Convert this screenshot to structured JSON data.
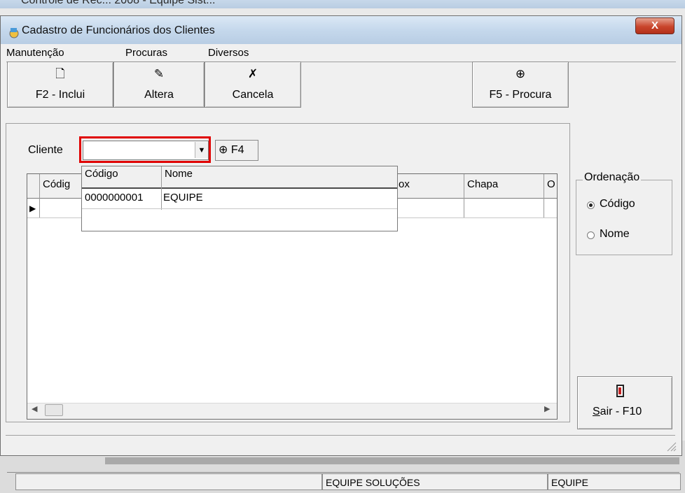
{
  "parent_window": {
    "title": "Controle de Rec... 2008 - Equipe Sist...",
    "status_cells": [
      "",
      "EQUIPE SOLUÇÕES",
      "EQUIPE"
    ]
  },
  "dialog": {
    "title": "Cadastro de Funcionários dos Clientes",
    "close_label": "X"
  },
  "menu": [
    "Manutenção",
    "Procuras",
    "Diversos"
  ],
  "toolbar": {
    "include": {
      "icon": "new-document-icon",
      "label": "F2 - Inclui"
    },
    "edit": {
      "icon": "edit-document-icon",
      "label": "Altera"
    },
    "cancel": {
      "icon": "cancel-icon",
      "label": "Cancela"
    },
    "search": {
      "icon": "magnifier-icon",
      "label": "F5 - Procura"
    }
  },
  "filter": {
    "cliente_label": "Cliente",
    "cliente_value": "",
    "f4_label": "F4"
  },
  "grid": {
    "columns": [
      "Códig",
      "ox",
      "Chapa",
      "O"
    ]
  },
  "dropdown": {
    "columns": [
      "Código",
      "Nome"
    ],
    "rows": [
      {
        "codigo": "0000000001",
        "nome": "EQUIPE"
      }
    ]
  },
  "ordering": {
    "legend": "Ordenação",
    "options": [
      {
        "label": "Código",
        "selected": true
      },
      {
        "label": "Nome",
        "selected": false
      }
    ]
  },
  "exit": {
    "label_prefix": "S",
    "label_rest": "air - F10"
  },
  "colors": {
    "highlight": "#e00000",
    "close_button": "#c9452c"
  }
}
